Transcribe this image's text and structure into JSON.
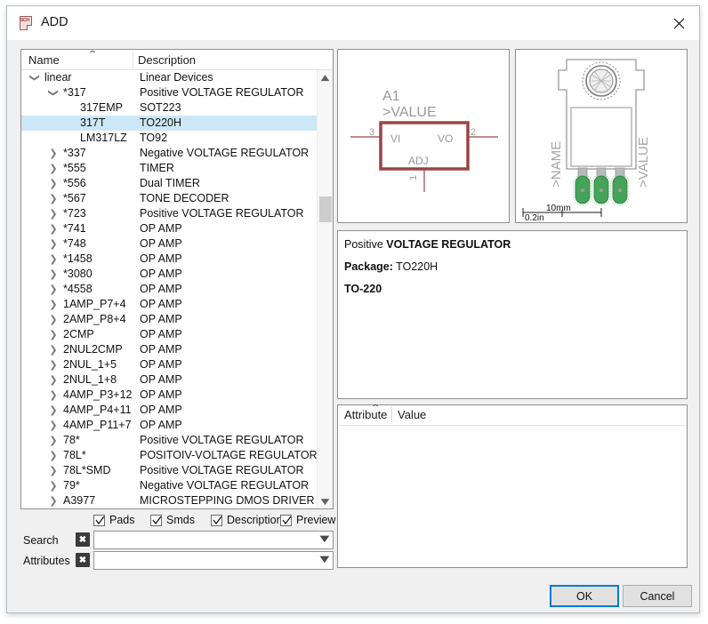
{
  "window": {
    "title": "ADD",
    "icon": "schematic-file-icon",
    "close_icon": "close-icon"
  },
  "tree": {
    "headers": {
      "name": "Name",
      "description": "Description"
    },
    "sort_indicator": "⌃",
    "rows": [
      {
        "level": 0,
        "arrow": "expanded",
        "name": "linear",
        "description": "Linear Devices",
        "selected": false
      },
      {
        "level": 1,
        "arrow": "expanded",
        "name": "*317",
        "description": "Positive VOLTAGE REGULATOR",
        "selected": false
      },
      {
        "level": 2,
        "arrow": "none",
        "name": "317EMP",
        "description": "SOT223",
        "selected": false
      },
      {
        "level": 2,
        "arrow": "none",
        "name": "317T",
        "description": "TO220H",
        "selected": true
      },
      {
        "level": 2,
        "arrow": "none",
        "name": "LM317LZ",
        "description": "TO92",
        "selected": false
      },
      {
        "level": 1,
        "arrow": "collapsed",
        "name": "*337",
        "description": "Negative VOLTAGE REGULATOR",
        "selected": false
      },
      {
        "level": 1,
        "arrow": "collapsed",
        "name": "*555",
        "description": "TIMER",
        "selected": false
      },
      {
        "level": 1,
        "arrow": "collapsed",
        "name": "*556",
        "description": "Dual TIMER",
        "selected": false
      },
      {
        "level": 1,
        "arrow": "collapsed",
        "name": "*567",
        "description": "TONE DECODER",
        "selected": false
      },
      {
        "level": 1,
        "arrow": "collapsed",
        "name": "*723",
        "description": "Positive VOLTAGE REGULATOR",
        "selected": false
      },
      {
        "level": 1,
        "arrow": "collapsed",
        "name": "*741",
        "description": "OP AMP",
        "selected": false
      },
      {
        "level": 1,
        "arrow": "collapsed",
        "name": "*748",
        "description": "OP AMP",
        "selected": false
      },
      {
        "level": 1,
        "arrow": "collapsed",
        "name": "*1458",
        "description": "OP AMP",
        "selected": false
      },
      {
        "level": 1,
        "arrow": "collapsed",
        "name": "*3080",
        "description": "OP AMP",
        "selected": false
      },
      {
        "level": 1,
        "arrow": "collapsed",
        "name": "*4558",
        "description": "OP AMP",
        "selected": false
      },
      {
        "level": 1,
        "arrow": "collapsed",
        "name": "1AMP_P7+4",
        "description": "OP AMP",
        "selected": false
      },
      {
        "level": 1,
        "arrow": "collapsed",
        "name": "2AMP_P8+4",
        "description": "OP AMP",
        "selected": false
      },
      {
        "level": 1,
        "arrow": "collapsed",
        "name": "2CMP",
        "description": "OP AMP",
        "selected": false
      },
      {
        "level": 1,
        "arrow": "collapsed",
        "name": "2NUL2CMP",
        "description": "OP AMP",
        "selected": false
      },
      {
        "level": 1,
        "arrow": "collapsed",
        "name": "2NUL_1+5",
        "description": "OP AMP",
        "selected": false
      },
      {
        "level": 1,
        "arrow": "collapsed",
        "name": "2NUL_1+8",
        "description": "OP AMP",
        "selected": false
      },
      {
        "level": 1,
        "arrow": "collapsed",
        "name": "4AMP_P3+12",
        "description": "OP AMP",
        "selected": false
      },
      {
        "level": 1,
        "arrow": "collapsed",
        "name": "4AMP_P4+11",
        "description": "OP AMP",
        "selected": false
      },
      {
        "level": 1,
        "arrow": "collapsed",
        "name": "4AMP_P11+7",
        "description": "OP AMP",
        "selected": false
      },
      {
        "level": 1,
        "arrow": "collapsed",
        "name": "78*",
        "description": "Positive VOLTAGE REGULATOR",
        "selected": false
      },
      {
        "level": 1,
        "arrow": "collapsed",
        "name": "78L*",
        "description": "POSITOIV-VOLTAGE REGULATORS",
        "selected": false
      },
      {
        "level": 1,
        "arrow": "collapsed",
        "name": "78L*SMD",
        "description": "Positive VOLTAGE REGULATOR",
        "selected": false
      },
      {
        "level": 1,
        "arrow": "collapsed",
        "name": "79*",
        "description": "Negative VOLTAGE REGULATOR",
        "selected": false
      },
      {
        "level": 1,
        "arrow": "collapsed",
        "name": "A3977",
        "description": "MICROSTEPPING DMOS DRIVER WI...",
        "selected": false
      }
    ],
    "scrollbar": {
      "up_icon": "chevron-up-icon",
      "down_icon": "chevron-down-icon"
    }
  },
  "symbol_preview": {
    "name_label": "A1",
    "value_label": ">VALUE",
    "pins": [
      {
        "label": "VI",
        "number": "3"
      },
      {
        "label": "VO",
        "number": "2"
      },
      {
        "label": "ADJ",
        "number": "1"
      }
    ],
    "outline_color": "#9b4444"
  },
  "package_preview": {
    "name_label": ">NAME",
    "value_label": ">VALUE",
    "scale_mm": "10mm",
    "scale_in": "0.2in",
    "pad_color": "#3fa34d",
    "outline_color": "#9a9a9a"
  },
  "description": {
    "title_prefix": "Positive ",
    "title_bold": "VOLTAGE REGULATOR",
    "package_label": "Package:",
    "package_value": "TO220H",
    "package_family": "TO-220"
  },
  "attributes_table": {
    "headers": {
      "attribute": "Attribute",
      "value": "Value"
    },
    "sort_indicator": "⌃",
    "rows": []
  },
  "options": {
    "checkboxes": [
      {
        "label": "Pads",
        "checked": true
      },
      {
        "label": "Smds",
        "checked": true
      },
      {
        "label": "Description",
        "checked": true
      },
      {
        "label": "Preview",
        "checked": true
      }
    ]
  },
  "search": {
    "label": "Search",
    "value": "",
    "placeholder": "",
    "clear_icon": "clear-x-icon",
    "dropdown_icon": "chevron-down-icon"
  },
  "attributes_filter": {
    "label": "Attributes",
    "value": "",
    "placeholder": "",
    "clear_icon": "clear-x-icon",
    "dropdown_icon": "chevron-down-icon"
  },
  "footer": {
    "ok_label": "OK",
    "cancel_label": "Cancel",
    "accent_color": "#0078d7"
  }
}
